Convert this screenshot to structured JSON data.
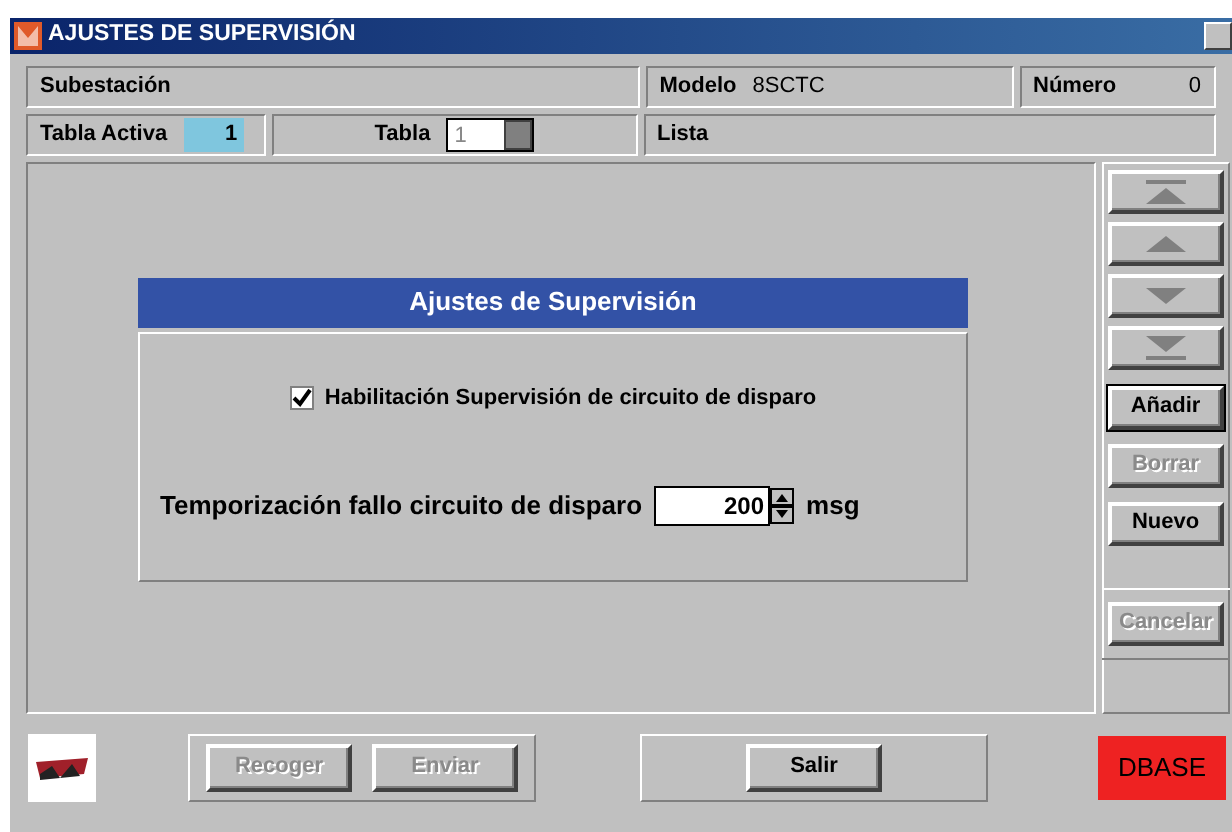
{
  "window": {
    "title": "AJUSTES DE SUPERVISIÓN"
  },
  "header": {
    "substation_label": "Subestación",
    "model_label": "Modelo",
    "model_value": "8SCTC",
    "number_label": "Número",
    "number_value": "0",
    "active_table_label": "Tabla Activa",
    "active_table_value": "1",
    "table_label": "Tabla",
    "table_value": "1",
    "list_label": "Lista"
  },
  "dialog": {
    "title": "Ajustes de Supervisión",
    "checkbox": {
      "label": "Habilitación Supervisión de circuito de disparo",
      "checked": true
    },
    "timer": {
      "label": "Temporización fallo circuito de disparo",
      "value": "200",
      "unit": "msg"
    }
  },
  "nav_buttons": [
    {
      "kind": "first",
      "disabled": true
    },
    {
      "kind": "prev",
      "disabled": true
    },
    {
      "kind": "next",
      "disabled": true
    },
    {
      "kind": "last",
      "disabled": true
    }
  ],
  "side_buttons": [
    {
      "label": "Añadir",
      "disabled": false,
      "focused": true
    },
    {
      "label": "Borrar",
      "disabled": true,
      "focused": false
    },
    {
      "label": "Nuevo",
      "disabled": false,
      "focused": false
    }
  ],
  "cancel_button": {
    "label": "Cancelar",
    "disabled": true
  },
  "bottom_buttons": [
    {
      "label": "Recoger",
      "disabled": true
    },
    {
      "label": "Enviar",
      "disabled": true
    }
  ],
  "exit_button": {
    "label": "Salir",
    "disabled": false
  },
  "status": {
    "label": "DBASE"
  }
}
